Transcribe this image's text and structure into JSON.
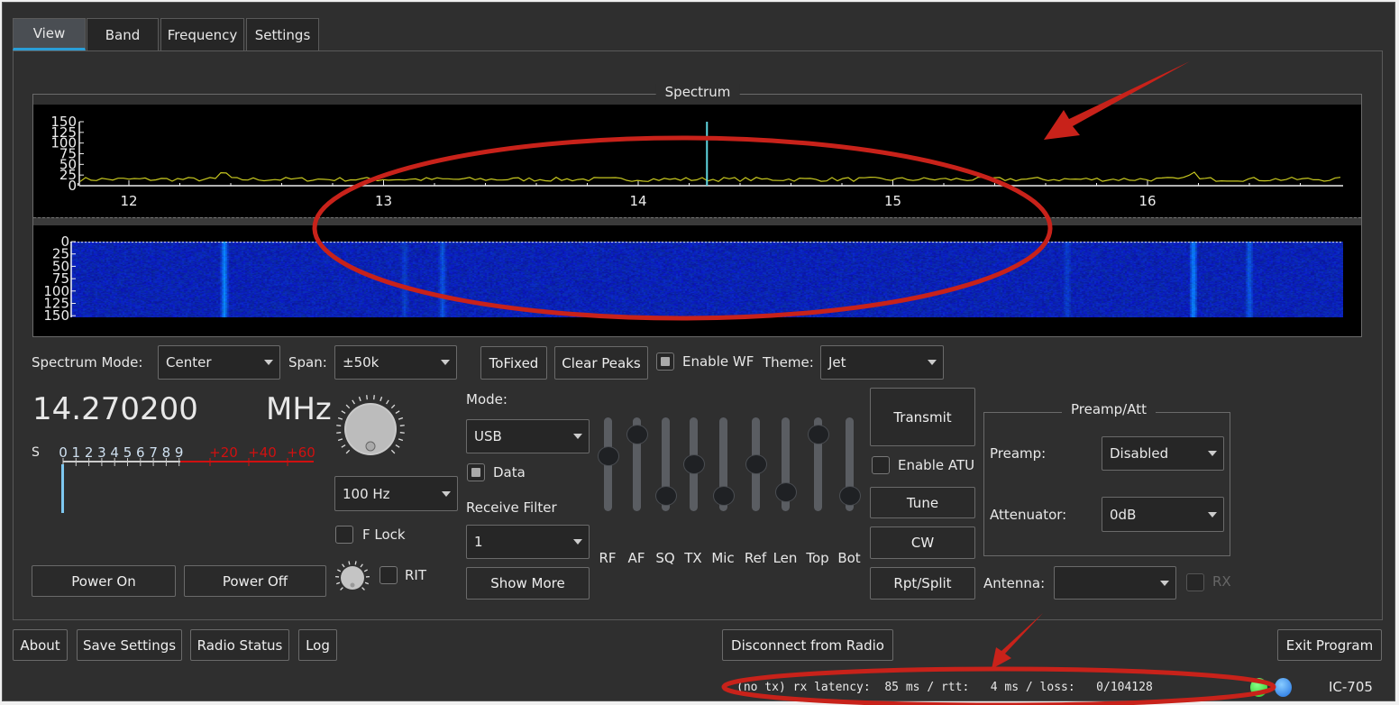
{
  "tabs": [
    {
      "label": "View",
      "active": true
    },
    {
      "label": "Band"
    },
    {
      "label": "Frequency"
    },
    {
      "label": "Settings"
    }
  ],
  "spectrum": {
    "title": "Spectrum",
    "x_ticks": [
      "12",
      "13",
      "14",
      "15",
      "16"
    ],
    "x_unit_values_mhz": [
      12,
      13,
      14,
      15,
      16
    ],
    "y_ticks": [
      "150",
      "125",
      "100",
      "75",
      "50",
      "25",
      "0"
    ],
    "wf_ticks": [
      "0",
      "25",
      "50",
      "75",
      "100",
      "125",
      "150"
    ],
    "center_marker_mhz": 14.27,
    "noise_floor": 15,
    "trace_color": "#c8c820",
    "marker_color": "#5fd6e0"
  },
  "controls": {
    "spectrum_mode_label": "Spectrum Mode:",
    "spectrum_mode_value": "Center",
    "span_label": "Span:",
    "span_value": "±50k",
    "tofixed": "ToFixed",
    "clear_peaks": "Clear Peaks",
    "enable_wf": "Enable WF",
    "enable_wf_checked": true,
    "theme_label": "Theme:",
    "theme_value": "Jet"
  },
  "frequency": {
    "value": "14.270200",
    "unit": "MHz",
    "step": "100 Hz",
    "flock": "F Lock",
    "rit": "RIT"
  },
  "smeter": {
    "s": "S",
    "scale": [
      "0",
      "1",
      "2",
      "3",
      "4",
      "5",
      "6",
      "7",
      "8",
      "9"
    ],
    "over": [
      "+20",
      "+40",
      "+60"
    ],
    "level": 0
  },
  "power": {
    "on": "Power On",
    "off": "Power Off"
  },
  "mode": {
    "label": "Mode:",
    "value": "USB",
    "data": "Data",
    "data_checked": true,
    "filter_label": "Receive Filter",
    "filter_value": "1",
    "show_more": "Show More"
  },
  "sliders": [
    {
      "label": "RF",
      "value": 0.6
    },
    {
      "label": "AF",
      "value": 0.88
    },
    {
      "label": "SQ",
      "value": 0.1
    },
    {
      "label": "TX",
      "value": 0.5
    },
    {
      "label": "Mic",
      "value": 0.1
    },
    {
      "label": "Ref",
      "value": 0.5
    },
    {
      "label": "Len",
      "value": 0.15
    },
    {
      "label": "Top",
      "value": 0.88
    },
    {
      "label": "Bot",
      "value": 0.1
    }
  ],
  "tx": {
    "transmit": "Transmit",
    "enable_atu": "Enable ATU",
    "tune": "Tune",
    "cw": "CW",
    "rpt_split": "Rpt/Split"
  },
  "preamp": {
    "title": "Preamp/Att",
    "preamp_label": "Preamp:",
    "preamp_value": "Disabled",
    "att_label": "Attenuator:",
    "att_value": "0dB"
  },
  "antenna": {
    "label": "Antenna:",
    "value": "",
    "rx": "RX"
  },
  "bottom": {
    "about": "About",
    "save": "Save Settings",
    "radio_status": "Radio Status",
    "log": "Log",
    "disconnect": "Disconnect from Radio",
    "exit": "Exit Program"
  },
  "status": {
    "text": "(no tx) rx latency:  85 ms / rtt:   4 ms / loss:   0/104128",
    "led1": "#22c322",
    "led2": "#1e6fe0",
    "radio": "IC-705"
  },
  "annotation_color": "#c8221a"
}
